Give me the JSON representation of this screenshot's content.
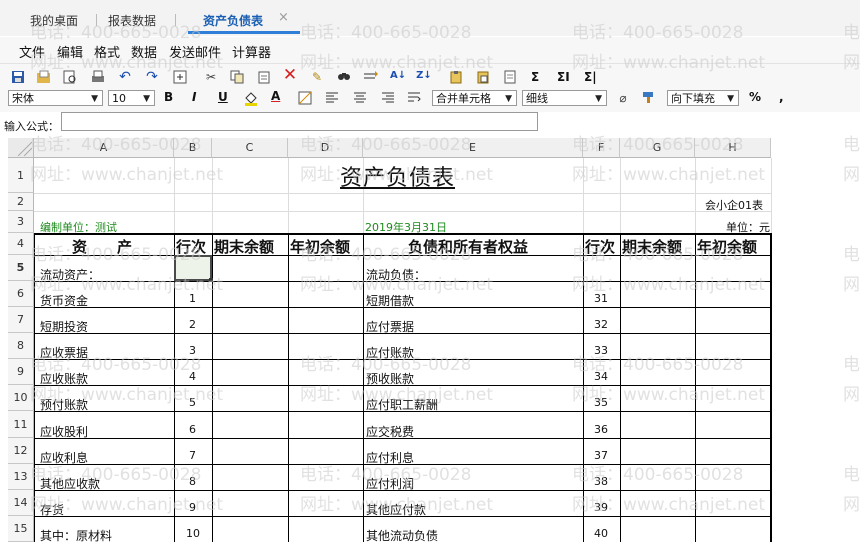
{
  "tabs": {
    "desktop": "我的桌面",
    "report_data": "报表数据",
    "balance_sheet": "资产负债表",
    "close": "×"
  },
  "menu": [
    "文件",
    "编辑",
    "格式",
    "数据",
    "发送邮件",
    "计算器"
  ],
  "toolbar": {
    "font": "宋体",
    "size": "10",
    "bold": "B",
    "italic": "I",
    "underline": "U",
    "underline_color": "A",
    "merge": "合并单元格",
    "border": "细线",
    "fill": "向下填充",
    "percent": "%",
    "comma": ",",
    "sum1": "Σ",
    "sum2": "ΣI",
    "sum3": "Σ|",
    "icons": [
      "save-icon",
      "open-icon",
      "preview-icon",
      "print-icon",
      "undo-icon",
      "redo-icon",
      "calc-icon",
      "cut-icon",
      "copy-icon",
      "paste-icon",
      "delete-icon",
      "brush-icon",
      "find-icon",
      "replace-icon",
      "sort-asc-icon",
      "sort-desc-icon",
      "paste-special-icon",
      "paste-value-icon",
      "page-icon"
    ]
  },
  "formula": {
    "label": "输入公式：",
    "value": ""
  },
  "columns": [
    "A",
    "B",
    "C",
    "D",
    "E",
    "F",
    "G",
    "H"
  ],
  "rows": [
    "1",
    "2",
    "3",
    "4",
    "5",
    "6",
    "7",
    "8",
    "9",
    "10",
    "11",
    "12",
    "13",
    "14",
    "15"
  ],
  "sheet": {
    "title": "资产负债表",
    "form_no": "会小企01表",
    "unit_org": "编制单位：测试",
    "date": "2019年3月31日",
    "currency_unit": "单位：元",
    "headers": [
      "资　　产",
      "行次",
      "期末余额",
      "年初余额",
      "负债和所有者权益",
      "行次",
      "期末余额",
      "年初余额"
    ],
    "assets": [
      "流动资产：",
      "货币资金",
      "短期投资",
      "应收票据",
      "应收账款",
      "预付账款",
      "应收股利",
      "应收利息",
      "其他应收款",
      "存货",
      "其中：原材料"
    ],
    "asset_lines": [
      "",
      "1",
      "2",
      "3",
      "4",
      "5",
      "6",
      "7",
      "8",
      "9",
      "10"
    ],
    "liabilities": [
      "流动负债：",
      "短期借款",
      "应付票据",
      "应付账款",
      "预收账款",
      "应付职工薪酬",
      "应交税费",
      "应付利息",
      "应付利润",
      "其他应付款",
      "其他流动负债"
    ],
    "liability_lines": [
      "",
      "31",
      "32",
      "33",
      "34",
      "35",
      "36",
      "37",
      "38",
      "39",
      "40"
    ]
  },
  "watermark": {
    "phone": "电话：400-665-0028",
    "site": "网址：www.chanjet.net",
    "phone_cut": "电",
    "site_cut": "网"
  },
  "colors": {
    "accent": "#2f7fd8",
    "green_text": "#1e8a1e",
    "tab_active": "#1a5fb4"
  }
}
